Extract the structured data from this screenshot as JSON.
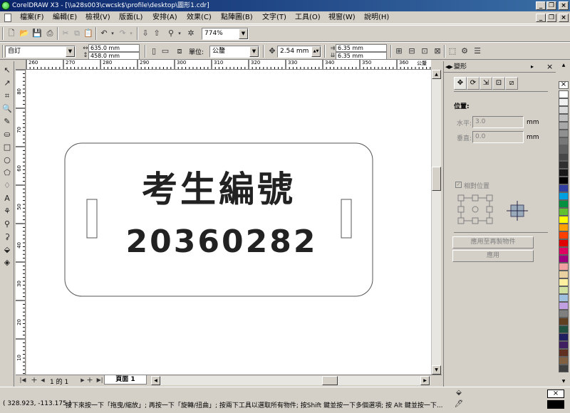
{
  "titlebar": {
    "title": "CorelDRAW X3 - [\\\\a28s003\\cwcsk$\\profile\\desktop\\圖形1.cdr]",
    "min": "_",
    "restore": "❐",
    "close": "×"
  },
  "menubar": {
    "items": [
      "檔案(F)",
      "編輯(E)",
      "檢視(V)",
      "版面(L)",
      "安排(A)",
      "效果(C)",
      "點陣圖(B)",
      "文字(T)",
      "工具(O)",
      "視窗(W)",
      "說明(H)"
    ],
    "min": "_",
    "restore": "❐",
    "close": "×"
  },
  "standard_toolbar": {
    "zoom": "774%"
  },
  "property_bar": {
    "paper_type": "自訂",
    "width": "635.0 mm",
    "height": "458.0 mm",
    "units_label": "單位:",
    "units": "公釐",
    "nudge": "2.54 mm",
    "dup_x": "6.35 mm",
    "dup_y": "6.35 mm"
  },
  "rulers": {
    "h_ticks": [
      "260",
      "270",
      "280",
      "290",
      "300",
      "310",
      "320",
      "330",
      "340",
      "350",
      "360"
    ],
    "v_ticks": [
      "80",
      "70",
      "60",
      "50",
      "40",
      "30",
      "20",
      "10",
      "0"
    ],
    "unit": "公釐"
  },
  "drawing": {
    "line1": "考生編號",
    "line2": "20360282"
  },
  "pagebar": {
    "page_count": "1 的 1",
    "page_tab": "頁面 1"
  },
  "docker": {
    "title": "變形",
    "section": "位置:",
    "h_label": "水平:",
    "h_value": "3.0",
    "v_label": "垂直:",
    "v_value": "0.0",
    "unit": "mm",
    "relative": "相對位置",
    "apply_dup": "應用至再製物件",
    "apply": "應用"
  },
  "palette": {
    "colors": [
      "#ffffff",
      "#f0f0f0",
      "#d8d8d8",
      "#c0c0c0",
      "#a8a8a8",
      "#909090",
      "#787878",
      "#606060",
      "#484848",
      "#303030",
      "#181818",
      "#000000",
      "#3040a0",
      "#00a0e0",
      "#009040",
      "#60c030",
      "#ffff00",
      "#ffa000",
      "#ff4000",
      "#e00000",
      "#e00060",
      "#a00080",
      "#f0a0a0",
      "#e8d0a0",
      "#fff0a0",
      "#d0e0a0",
      "#a0c0e0",
      "#c0a0e0",
      "#808080",
      "#604020",
      "#205040",
      "#202060",
      "#402060",
      "#603020",
      "#806040",
      "#404040"
    ]
  },
  "status": {
    "coords": "( 328.923, -113.175 )",
    "message": "按下來按一下「拖曳/縮放」; 再按一下「旋轉/扭曲」; 按兩下工具以選取所有物件; 按Shift 鍵並按一下多個選項; 按 Alt 鍵並按一下..."
  }
}
